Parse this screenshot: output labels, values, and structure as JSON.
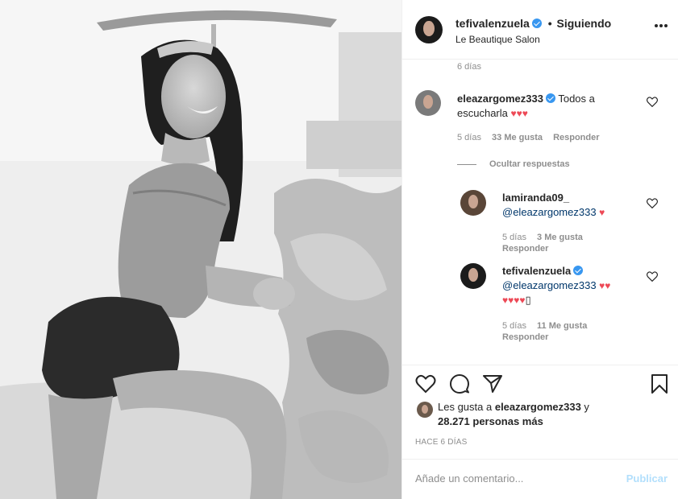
{
  "post": {
    "photo_description_icon": "photo",
    "brand_color": "#3897f0"
  },
  "header": {
    "username": "tefivalenzuela",
    "dot": "•",
    "follow_status": "Siguiendo",
    "location": "Le Beautique Salon"
  },
  "comments": {
    "top_time": "6 días",
    "items": [
      {
        "username": "eleazargomez333",
        "text": "Todos a escucharla",
        "hearts": "♥♥♥",
        "time": "5 días",
        "likes": "33 Me gusta",
        "reply": "Responder"
      }
    ],
    "hide_replies": "Ocultar respuestas",
    "replies": [
      {
        "username": "lamiranda09_",
        "mention": "@eleazargomez333",
        "hearts": "♥",
        "time": "5 días",
        "likes": "3 Me gusta",
        "reply": "Responder"
      },
      {
        "username": "tefivalenzuela",
        "mention": "@eleazargomez333",
        "hearts_line1": "♥♥",
        "hearts_line2": "♥♥♥♥",
        "trailing": "▯",
        "time": "5 días",
        "likes": "11 Me gusta",
        "reply": "Responder"
      }
    ]
  },
  "likes": {
    "prefix": "Les gusta a",
    "user": "eleazargomez333",
    "conj": "y",
    "count": "28.271 personas más"
  },
  "time_ago": "HACE 6 DÍAS",
  "add_comment": {
    "placeholder": "Añade un comentario...",
    "publish": "Publicar"
  },
  "colors": {
    "heart": "#ed4956",
    "mention": "#00376b",
    "muted": "#8e8e8e",
    "publish_disabled": "#b2dffc"
  }
}
